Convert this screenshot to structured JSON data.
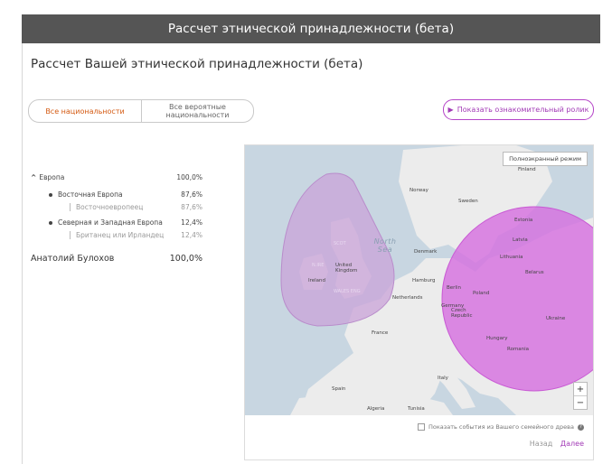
{
  "header": {
    "title": "Рассчет этнической принадлежности (бета)"
  },
  "page": {
    "subtitle": "Рассчет Вашей этнической принадлежности (бета)"
  },
  "tabs": [
    {
      "label": "Все национальности",
      "active": true
    },
    {
      "label": "Все вероятные национальности",
      "active": false
    }
  ],
  "video_button": {
    "label": "Показать ознакомительный ролик"
  },
  "ethnicity": {
    "region": {
      "name": "Европа",
      "percent": "100,0%"
    },
    "groups": [
      {
        "name": "Восточная Европа",
        "percent": "87,6%",
        "sub": {
          "name": "Восточноевропеец",
          "percent": "87,6%"
        }
      },
      {
        "name": "Северная и Западная Европа",
        "percent": "12,4%",
        "sub": {
          "name": "Британец или Ирландец",
          "percent": "12,4%"
        }
      }
    ],
    "person": {
      "name": "Анатолий Булохов",
      "percent": "100,0%"
    }
  },
  "map": {
    "fullscreen_label": "Полноэкранный режим",
    "zoom_in": "+",
    "zoom_out": "−",
    "labels": {
      "finland": "Finland",
      "norway": "Norway",
      "sweden": "Sweden",
      "estonia": "Estonia",
      "latvia": "Latvia",
      "lithuania": "Lithuania",
      "denmark": "Denmark",
      "north_sea": "North Sea",
      "uk": "United Kingdom",
      "scot": "SCOT",
      "nire": "N.IRE",
      "wales_eng": "WALES ENG",
      "ireland": "Ireland",
      "netherlands": "Netherlands",
      "hamburg": "Hamburg",
      "berlin": "Berlin",
      "poland": "Poland",
      "belarus": "Belarus",
      "germany": "Germany",
      "czech": "Czech Republic",
      "ukraine": "Ukraine",
      "france": "France",
      "hungary": "Hungary",
      "romania": "Romania",
      "italy": "Italy",
      "spain": "Spain",
      "algeria": "Algeria",
      "tunisia": "Tunisia"
    },
    "colors": {
      "west_region": "#c9a3d8",
      "east_region": "#d66ee0",
      "water": "#c8d6e1",
      "land": "#ececec"
    }
  },
  "footer": {
    "show_events": "Показать события из Вашего семейного древа",
    "back": "Назад",
    "next": "Далее"
  }
}
